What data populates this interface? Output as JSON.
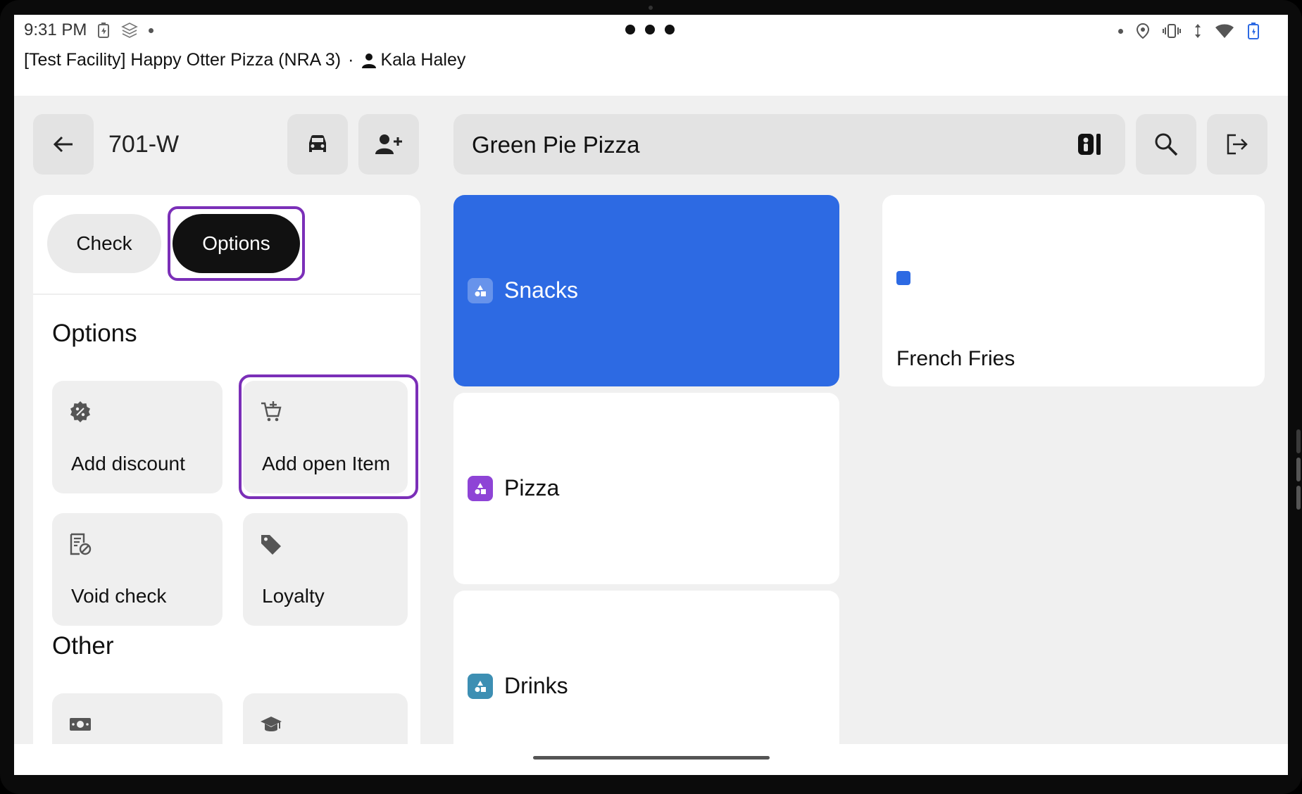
{
  "status_bar": {
    "time": "9:31 PM"
  },
  "header": {
    "facility": "[Test Facility] Happy Otter Pizza (NRA 3)",
    "separator": "·",
    "user": "Kala Haley"
  },
  "order": {
    "number": "701-W"
  },
  "menu": {
    "name": "Green Pie Pizza"
  },
  "tabs": {
    "check": "Check",
    "options": "Options",
    "active": "Options"
  },
  "options_section": {
    "heading": "Options",
    "items": [
      {
        "label": "Add discount",
        "icon": "discount-icon"
      },
      {
        "label": "Add open Item",
        "icon": "add-cart-icon"
      },
      {
        "label": "Void check",
        "icon": "void-check-icon"
      },
      {
        "label": "Loyalty",
        "icon": "tag-icon"
      }
    ]
  },
  "other_section": {
    "heading": "Other",
    "items": [
      {
        "label": "",
        "icon": "cash-icon"
      },
      {
        "label": "",
        "icon": "graduation-cap-icon"
      }
    ]
  },
  "categories": [
    {
      "name": "Snacks",
      "selected": true,
      "color": "#2d6ae3"
    },
    {
      "name": "Pizza",
      "selected": false,
      "color": "#8e44d6"
    },
    {
      "name": "Drinks",
      "selected": false,
      "color": "#3d8fb3"
    }
  ],
  "items": [
    {
      "name": "French Fries",
      "color": "#2d6ae3"
    }
  ],
  "colors": {
    "accent": "#2d6ae3",
    "highlight": "#7b2fb8",
    "active_tab": "#111111"
  }
}
